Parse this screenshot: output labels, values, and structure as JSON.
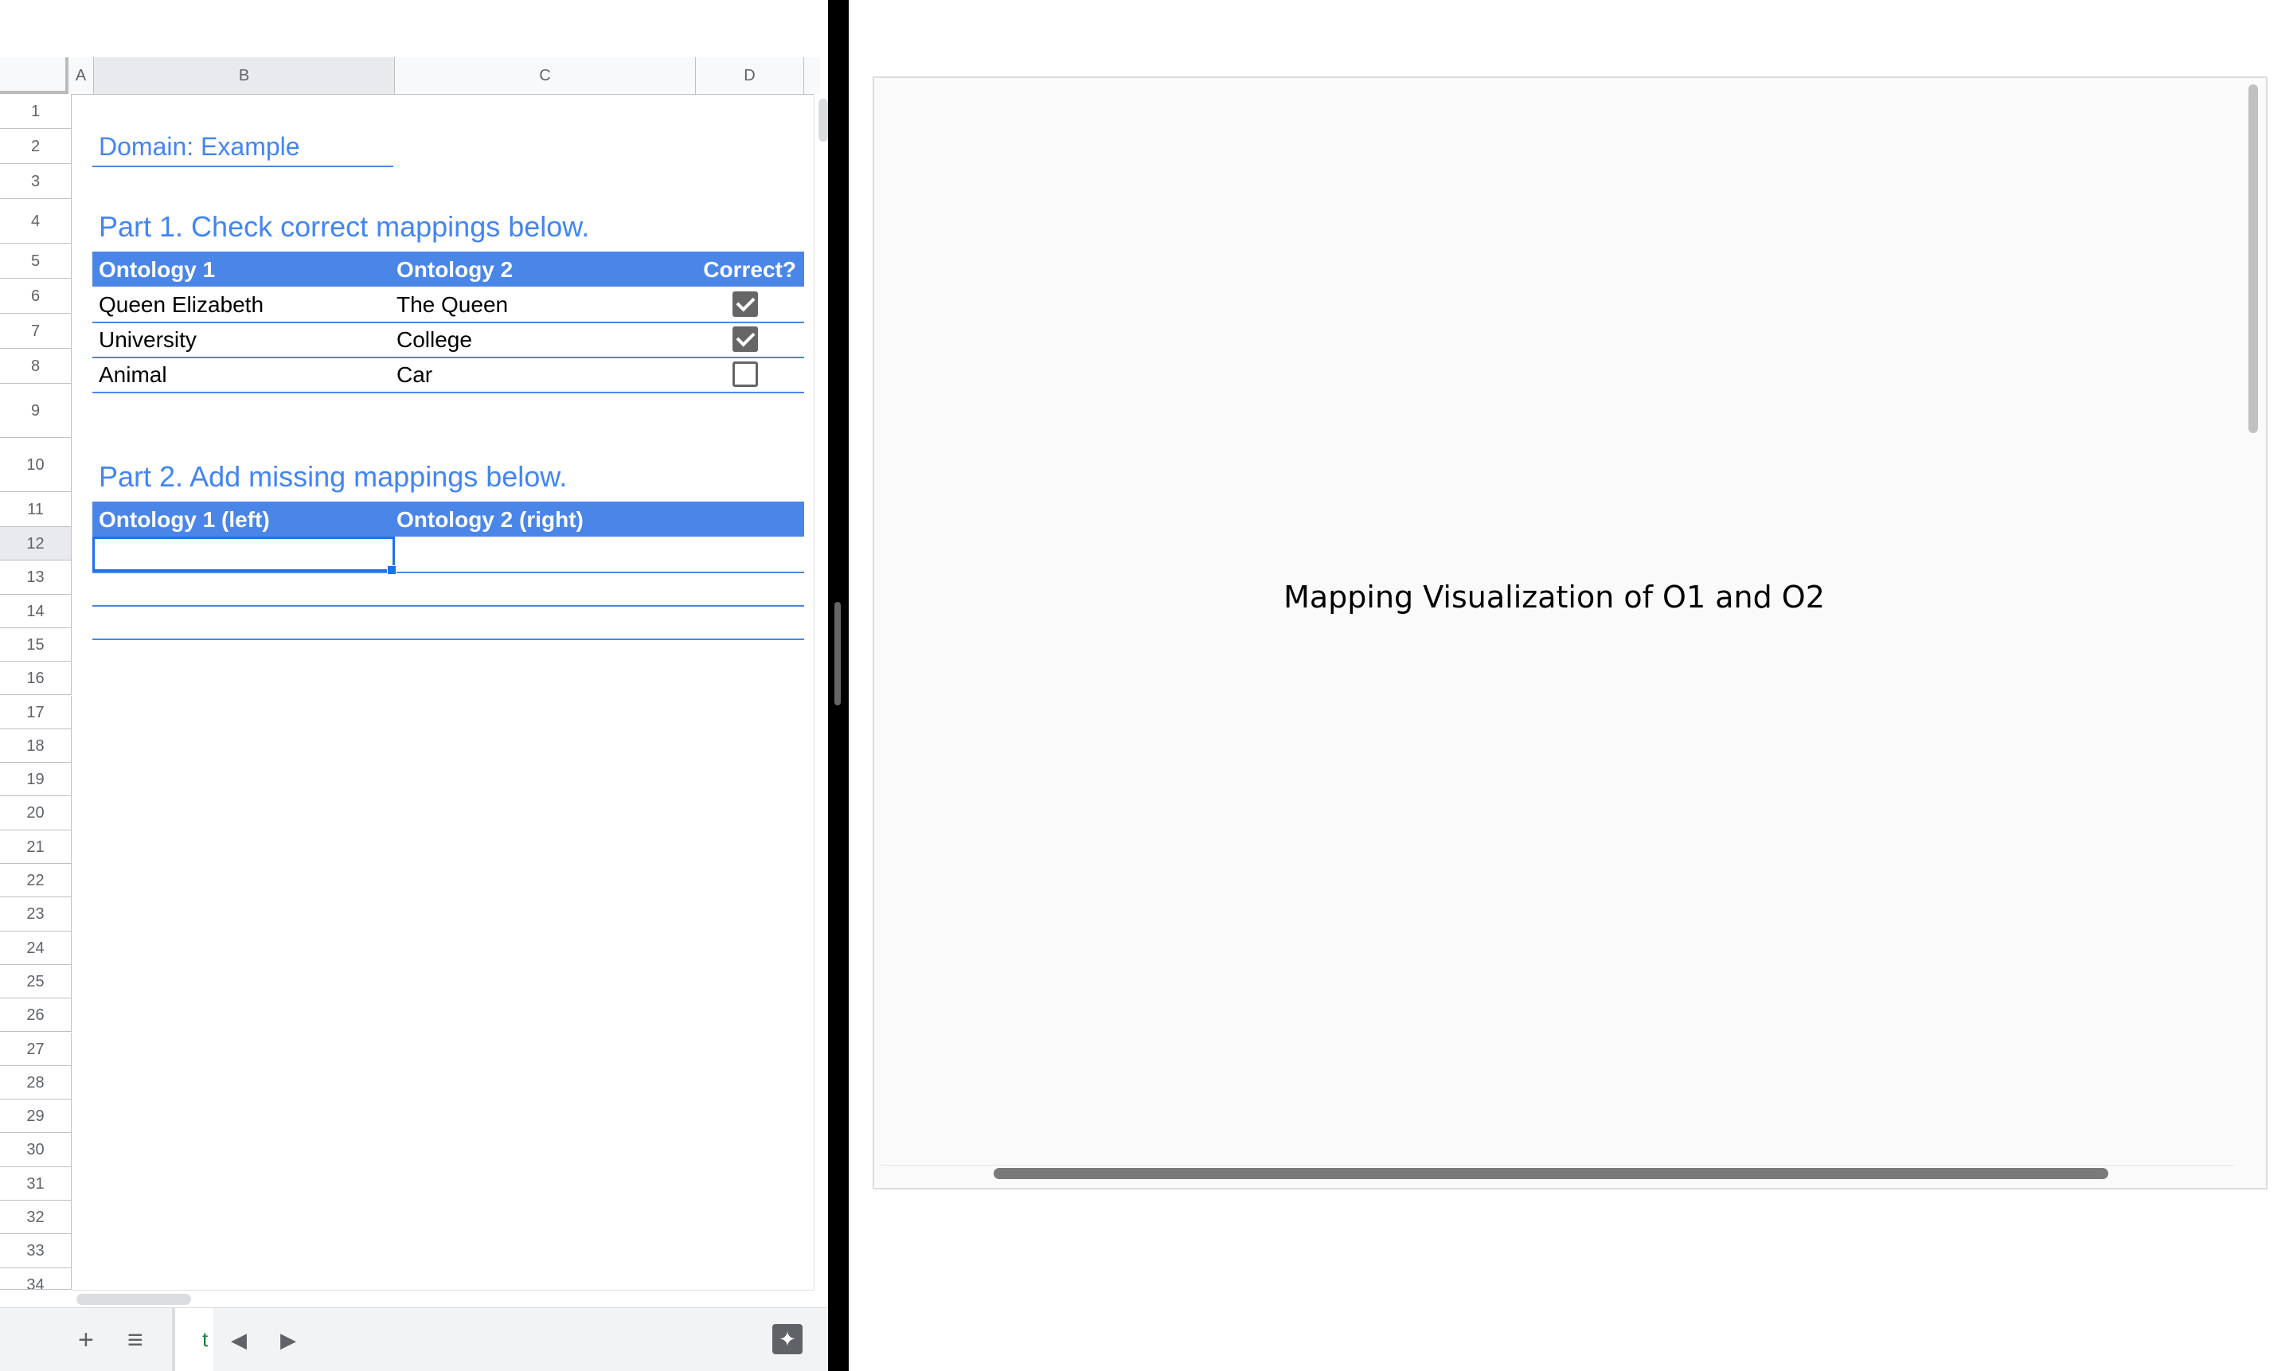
{
  "columns": [
    "A",
    "B",
    "C",
    "D"
  ],
  "rows": [
    "1",
    "2",
    "3",
    "4",
    "5",
    "6",
    "7",
    "8",
    "9",
    "10",
    "11",
    "12",
    "13",
    "14",
    "15",
    "16",
    "17",
    "18",
    "19",
    "20",
    "21",
    "22",
    "23",
    "24",
    "25",
    "26",
    "27",
    "28",
    "29",
    "30",
    "31",
    "32",
    "33",
    "34"
  ],
  "domain_label": "Domain: Example",
  "part1": {
    "title": "Part 1. Check correct mappings below.",
    "headers": [
      "Ontology 1",
      "Ontology 2",
      "Correct?"
    ],
    "mappings": [
      {
        "o1": "Queen Elizabeth",
        "o2": "The Queen",
        "correct": true
      },
      {
        "o1": "University",
        "o2": "College",
        "correct": true
      },
      {
        "o1": "Animal",
        "o2": "Car",
        "correct": false
      }
    ]
  },
  "part2": {
    "title": "Part 2. Add missing mappings below.",
    "headers": [
      "Ontology 1 (left)",
      "Ontology 2 (right)"
    ]
  },
  "sheet_tab_partial": "t",
  "bottom_icons": [
    "plus-icon",
    "list-icon",
    "arrow-left-icon",
    "arrow-right-icon",
    "explore-icon"
  ],
  "visualization": {
    "title": "Mapping Visualization of O1 and O2"
  },
  "colors": {
    "accent": "#4285f4",
    "header_fill": "#4a86e8",
    "checkbox": "#666666"
  }
}
